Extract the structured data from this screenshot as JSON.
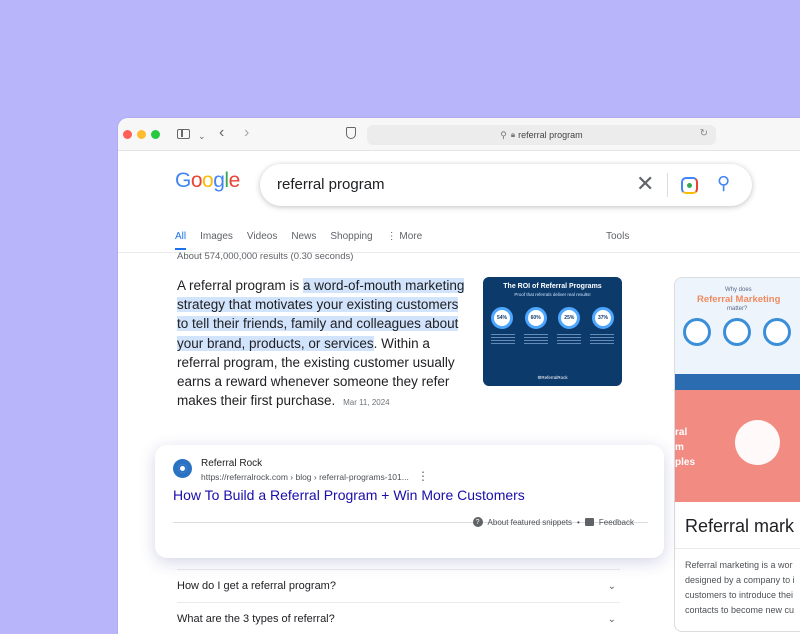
{
  "browser": {
    "address": "referral program"
  },
  "google": {
    "logo": [
      "G",
      "o",
      "o",
      "g",
      "l",
      "e"
    ],
    "logo_colors": [
      "#4285f4",
      "#ea4335",
      "#fbbc05",
      "#4285f4",
      "#34a853",
      "#ea4335"
    ],
    "query": "referral program",
    "tabs": [
      "All",
      "Images",
      "Videos",
      "News",
      "Shopping",
      "⋮ More"
    ],
    "tools_label": "Tools",
    "results_count": "About 574,000,000 results (0.30 seconds)"
  },
  "featured": {
    "text_plain_start": "A referral program is ",
    "text_highlight": "a word-of-mouth marketing strategy that motivates your existing customers to tell their friends, family and colleagues about your brand, products, or services",
    "text_plain_end": ". Within a referral program, the existing customer usually earns a reward whenever someone they refer makes their first purchase.",
    "date": "Mar 11, 2024",
    "thumb": {
      "title": "The ROI of Referral Programs",
      "subtitle": "Proof that referrals deliver real results!",
      "rings": [
        "54%",
        "60%",
        "25%",
        "37%"
      ],
      "brand": "⚙ReferralRock"
    }
  },
  "result_card": {
    "site_name": "Referral Rock",
    "url": "https://referralrock.com › blog › referral-programs-101...",
    "title": "How To Build a Referral Program + Win More Customers",
    "about": "About featured snippets",
    "dot": "•",
    "feedback": "Feedback"
  },
  "faq": [
    "How do I get a referral program?",
    "What are the 3 types of referral?"
  ],
  "knowledge_panel": {
    "img_why": "Why does",
    "img_rm": "Referral Marketing",
    "img_matter": "matter?",
    "img2_text": "ral\nm\nples",
    "title": "Referral mark",
    "desc_lines": [
      "Referral marketing is a wor",
      "designed by a company to i",
      "customers to introduce thei",
      "contacts to become new cu"
    ]
  },
  "colors": {
    "background": "#b9b5fb",
    "link": "#1a0dab",
    "accent": "#1a73e8",
    "highlight": "#d2e3fc"
  }
}
